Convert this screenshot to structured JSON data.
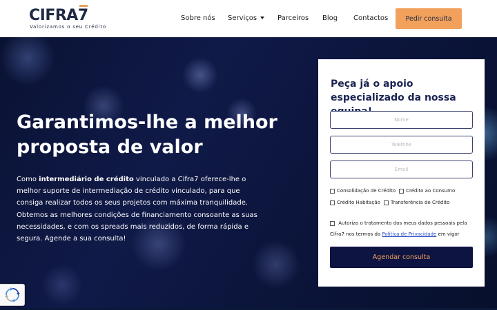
{
  "brand": {
    "logo_main": "CIFRA",
    "logo_seven": "7",
    "tagline": "Valorizamos o seu Crédito",
    "accent": "#f2a15d",
    "navy": "#1a2352"
  },
  "nav": {
    "items": [
      {
        "label": "Sobre nós"
      },
      {
        "label": "Serviços"
      },
      {
        "label": "Parceiros"
      },
      {
        "label": "Blog"
      },
      {
        "label": "Contactos"
      }
    ],
    "cta": "Pedir consulta"
  },
  "hero": {
    "headline": "Garantimos-lhe a melhor proposta de valor",
    "para_pre": "Como ",
    "para_bold": "intermediário de crédito",
    "para_post": " vinculado a Cifra7 oferece-lhe o melhor suporte de intermediação de crédito vinculado, para que consiga realizar todos os seus projetos com máxima tranquilidade. Obtemos as melhores condições de financiamento consoante as suas necessidades, e com os spreads mais reduzidos, de forma rápida e segura. Agende a sua consulta!"
  },
  "form": {
    "title": "Peça já o apoio especializado da nossa equipa!",
    "name_placeholder": "Nome",
    "phone_placeholder": "Telefone",
    "email_placeholder": "Email",
    "options": [
      "Consolidação de Crédito",
      "Crédito ao Consumo",
      "Crédito Habitação",
      "Transferência de Crédito"
    ],
    "consent_pre": "Autorizo o tratamento dos meus dados pessoais pela Cifra7 nos termos da ",
    "consent_link": "Política de Privacidade",
    "consent_post": " em vigor",
    "submit": "Agendar consulta"
  },
  "icons": {
    "nav_dropdown": "chevron-down-icon",
    "recaptcha": "recaptcha-icon"
  }
}
